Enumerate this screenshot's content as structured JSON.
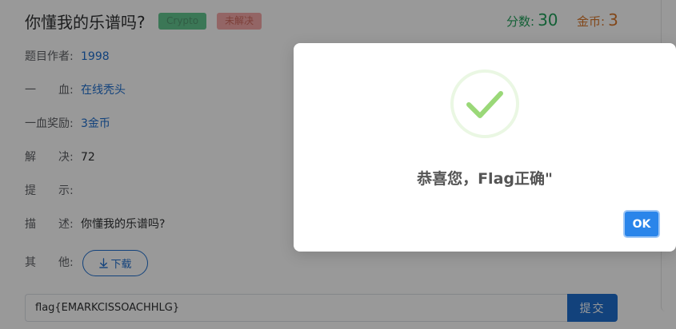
{
  "challenge": {
    "title": "你懂我的乐谱吗?",
    "category_tag": "Crypto",
    "status_tag": "未解决",
    "score_label": "分数:",
    "score_value": "30",
    "coins_label": "金币:",
    "coins_value": "3",
    "details": [
      {
        "label": "题目作者:",
        "value": "1998"
      },
      {
        "label": "一　　血:",
        "value": "在线秃头"
      },
      {
        "label": "一血奖励:",
        "value": "3金币"
      },
      {
        "label": "解　　决:",
        "value": "72"
      },
      {
        "label": "提　　示:",
        "value": ""
      },
      {
        "label": "描　　述:",
        "value": "你懂我的乐谱吗?"
      },
      {
        "label": "其　　他:",
        "value": ""
      }
    ],
    "download_label": "下载",
    "download_icon": "download-arrow-icon",
    "flag_input_value": "flag{EMARKCISSOACHHLG}",
    "submit_label": "提交"
  },
  "dialog": {
    "icon": "success-checkmark-icon",
    "message": "恭喜您，Flag正确\"",
    "ok_label": "OK"
  },
  "colors": {
    "link": "#1f6fcf",
    "points": "#21a05a",
    "coins": "#d9772a",
    "success_check": "#9ad878",
    "ok_button": "#2a85ea",
    "overlay": "rgba(0,0,0,0.4)"
  }
}
